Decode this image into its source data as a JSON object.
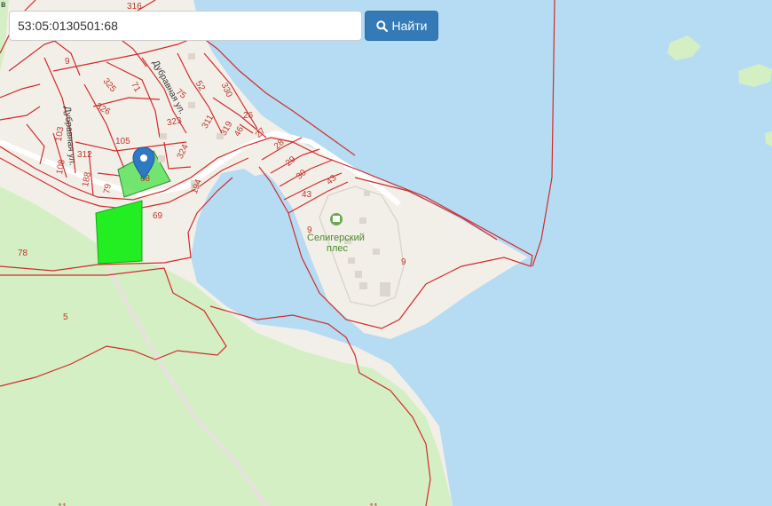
{
  "search": {
    "query": "53:05:0130501:68",
    "button_label": "Найти"
  },
  "map": {
    "place_name_line1": "Селигерский",
    "place_name_line2": "плес",
    "street_dubravnaya": "Дубравная ул.",
    "street_side": "Дубравная ул.",
    "corner_label": "в",
    "parcel_labels": {
      "p316": "316",
      "p9a": "9",
      "p325": "325",
      "p71": "71",
      "p75": "75",
      "p52": "52",
      "p330": "330",
      "p326": "326",
      "p323": "323",
      "p311": "311",
      "p319": "319",
      "p46": "46",
      "p26": "26",
      "p27": "27",
      "p103": "103",
      "p105": "105",
      "p324": "324",
      "p28": "28",
      "p312": "312",
      "p29": "29",
      "p108": "108",
      "p188": "188",
      "p79": "79",
      "p68": "68",
      "p30": "30",
      "p194": "194",
      "p43a": "43",
      "p43b": "43",
      "p69": "69",
      "p9b": "9",
      "p9c": "9",
      "p78": "78",
      "p5": "5",
      "p11a": "11",
      "p11b": "11"
    }
  },
  "colors": {
    "water": "#b5dcf3",
    "land": "#f2efe9",
    "forest": "#d4efc4",
    "boundary": "#d12b2b",
    "selected_parcel": "#5ce35c",
    "bright_parcel": "#22ee22",
    "marker": "#2f78c4",
    "button": "#337ab7"
  },
  "icons": {
    "marker": "map-pin-icon",
    "search": "search-icon",
    "poi": "lodging-icon"
  }
}
